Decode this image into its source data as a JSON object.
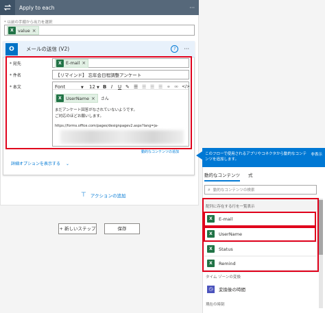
{
  "loop": {
    "title": "Apply to each",
    "more": "···",
    "select_label": "* 以前の手順から出力を選択",
    "value_token": "value"
  },
  "email": {
    "title": "メールの送信 (V2)",
    "help": "?",
    "more": "···",
    "to_label": "* 宛先",
    "to_token": "E-mail",
    "subject_label": "* 件名",
    "subject_value": "【リマインド】 忘年会日程調整アンケート",
    "body_label": "* 本文",
    "font_value": "Font",
    "size_value": "12",
    "bold": "B",
    "italic": "I",
    "underline": "U",
    "username_token": "UserName",
    "san": "さん",
    "line1": "まだアンケート回答がなされていないようです。",
    "line2": "ご対応のほどお願いします。",
    "url": "https://forms.office.com/pages/designpagev2.aspx?lang=ja-",
    "advanced_link": "詳細オプションを表示する",
    "dyn_link": "動的なコンテンツの追加"
  },
  "add_action": "アクションの追加",
  "bottom": {
    "new_step": "+ 新しいステップ",
    "save": "保存"
  },
  "dynamic": {
    "banner": "このフローで使用されるアプリやコネクタから動的なコンテンツを追加します。",
    "hide": "非表示",
    "tab_dynamic": "動的なコンテンツ",
    "tab_expression": "式",
    "search_placeholder": "動的なコンテンツの検索",
    "section1": "配列に存在する行を一覧表示",
    "items": [
      "E-mail",
      "UserName",
      "Status",
      "Remind"
    ],
    "section2": "タイム ゾーンの変換",
    "converted_time": "変換後の時間",
    "section3": "現在の時刻"
  },
  "colors": {
    "accent": "#0078d4",
    "excel": "#217346",
    "highlight": "#e0001b"
  }
}
